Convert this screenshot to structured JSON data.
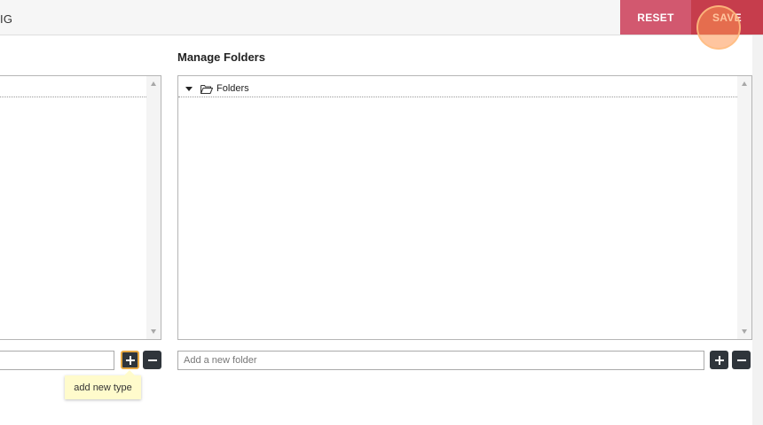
{
  "header": {
    "title_fragment": "IG",
    "reset_label": "RESET",
    "save_label": "SAVE"
  },
  "types_panel": {
    "input_placeholder": "",
    "tooltip": "add new type"
  },
  "folders_panel": {
    "title": "Manage Folders",
    "root_label": "Folders",
    "input_placeholder": "Add a new folder"
  },
  "colors": {
    "reset": "#d2586f",
    "save": "#c63d4c",
    "icon_button": "#2f353b",
    "tooltip_bg": "#fffbcc",
    "active_outline": "#e6a844"
  },
  "icons": {
    "tree_toggle": "caret-down-icon",
    "folder": "folder-open-icon",
    "add": "plus-icon",
    "remove": "minus-icon"
  }
}
